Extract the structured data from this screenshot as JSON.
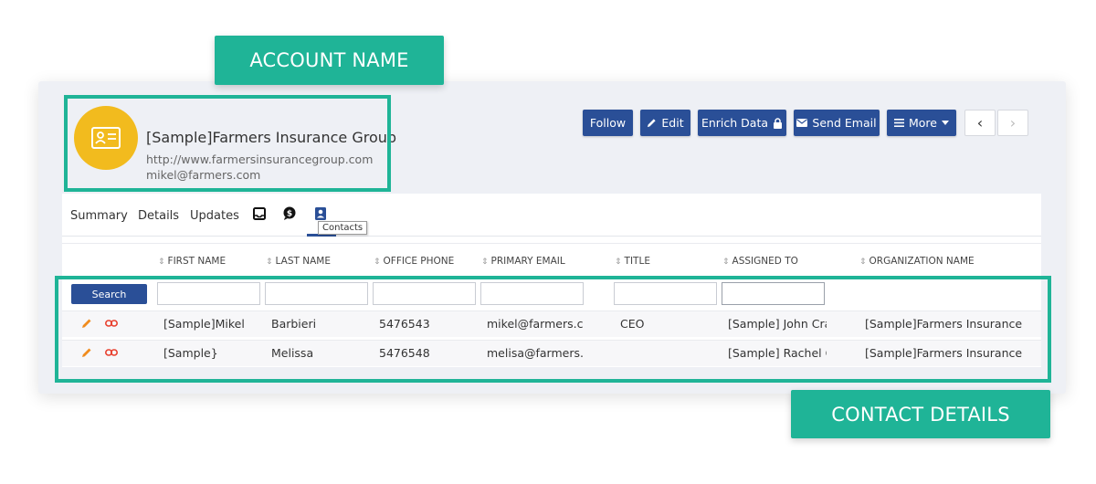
{
  "badges": {
    "account": "ACCOUNT NAME",
    "contact": "CONTACT DETAILS"
  },
  "account": {
    "avatar_icon": "contact-card-icon",
    "name": "[Sample]Farmers Insurance Group",
    "url": "http://www.farmersinsurancegroup.com",
    "email": "mikel@farmers.com"
  },
  "toolbar": {
    "follow": "Follow",
    "edit": "Edit",
    "enrich": "Enrich Data",
    "send_email": "Send Email",
    "more": "More",
    "prev": "‹",
    "next": "›"
  },
  "tabs": {
    "summary": "Summary",
    "details": "Details",
    "updates": "Updates",
    "tooltip": "Contacts"
  },
  "table": {
    "headers": [
      "FIRST NAME",
      "LAST NAME",
      "OFFICE PHONE",
      "PRIMARY EMAIL",
      "TITLE",
      "ASSIGNED TO",
      "ORGANIZATION NAME"
    ],
    "search_label": "Search",
    "rows": [
      [
        "[Sample]Mikel",
        "Barbieri",
        "5476543",
        "mikel@farmers.co",
        "CEO",
        "[Sample] John Craig",
        "[Sample]Farmers Insurance"
      ],
      [
        "[Sample}",
        "Melissa",
        "5476548",
        "melisa@farmers.c",
        "",
        "[Sample] Rachel Gr",
        "[Sample]Farmers Insurance"
      ]
    ]
  },
  "colors": {
    "accent": "#1fb497",
    "primary_button": "#2a4f97",
    "avatar": "#f2bb1e",
    "edit_icon": "#f08c1e",
    "link_icon": "#e8412f"
  }
}
